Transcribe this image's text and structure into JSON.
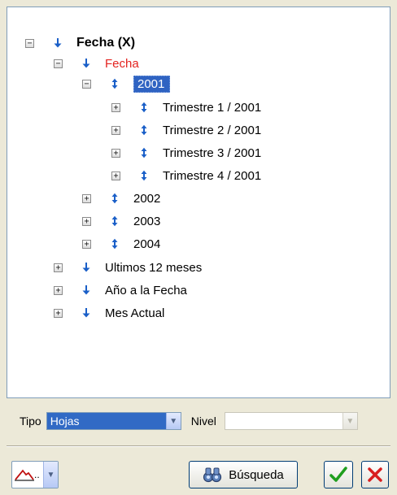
{
  "tree": {
    "root_label": "Fecha (X)",
    "fecha_label": "Fecha",
    "year_2001_label": "2001",
    "quarters": [
      "Trimestre 1 / 2001",
      "Trimestre 2 / 2001",
      "Trimestre 3 / 2001",
      "Trimestre 4 / 2001"
    ],
    "other_years": [
      "2002",
      "2003",
      "2004"
    ],
    "extras": [
      "Ultimos 12 meses",
      "Año a la Fecha",
      "Mes Actual"
    ],
    "toggle_expanded": "−",
    "toggle_collapsed": "+"
  },
  "filters": {
    "tipo_label": "Tipo",
    "tipo_value": "Hojas",
    "nivel_label": "Nivel",
    "nivel_value": ""
  },
  "toolbar": {
    "mode_ellipsis": "..",
    "search_label": "Búsqueda"
  },
  "colors": {
    "arrow_blue": "#1a5fc8",
    "selected_bg": "#2f63c2",
    "fecha_red": "#e3231f",
    "ok_green": "#1f9e1f",
    "cancel_red": "#d81f1f"
  }
}
